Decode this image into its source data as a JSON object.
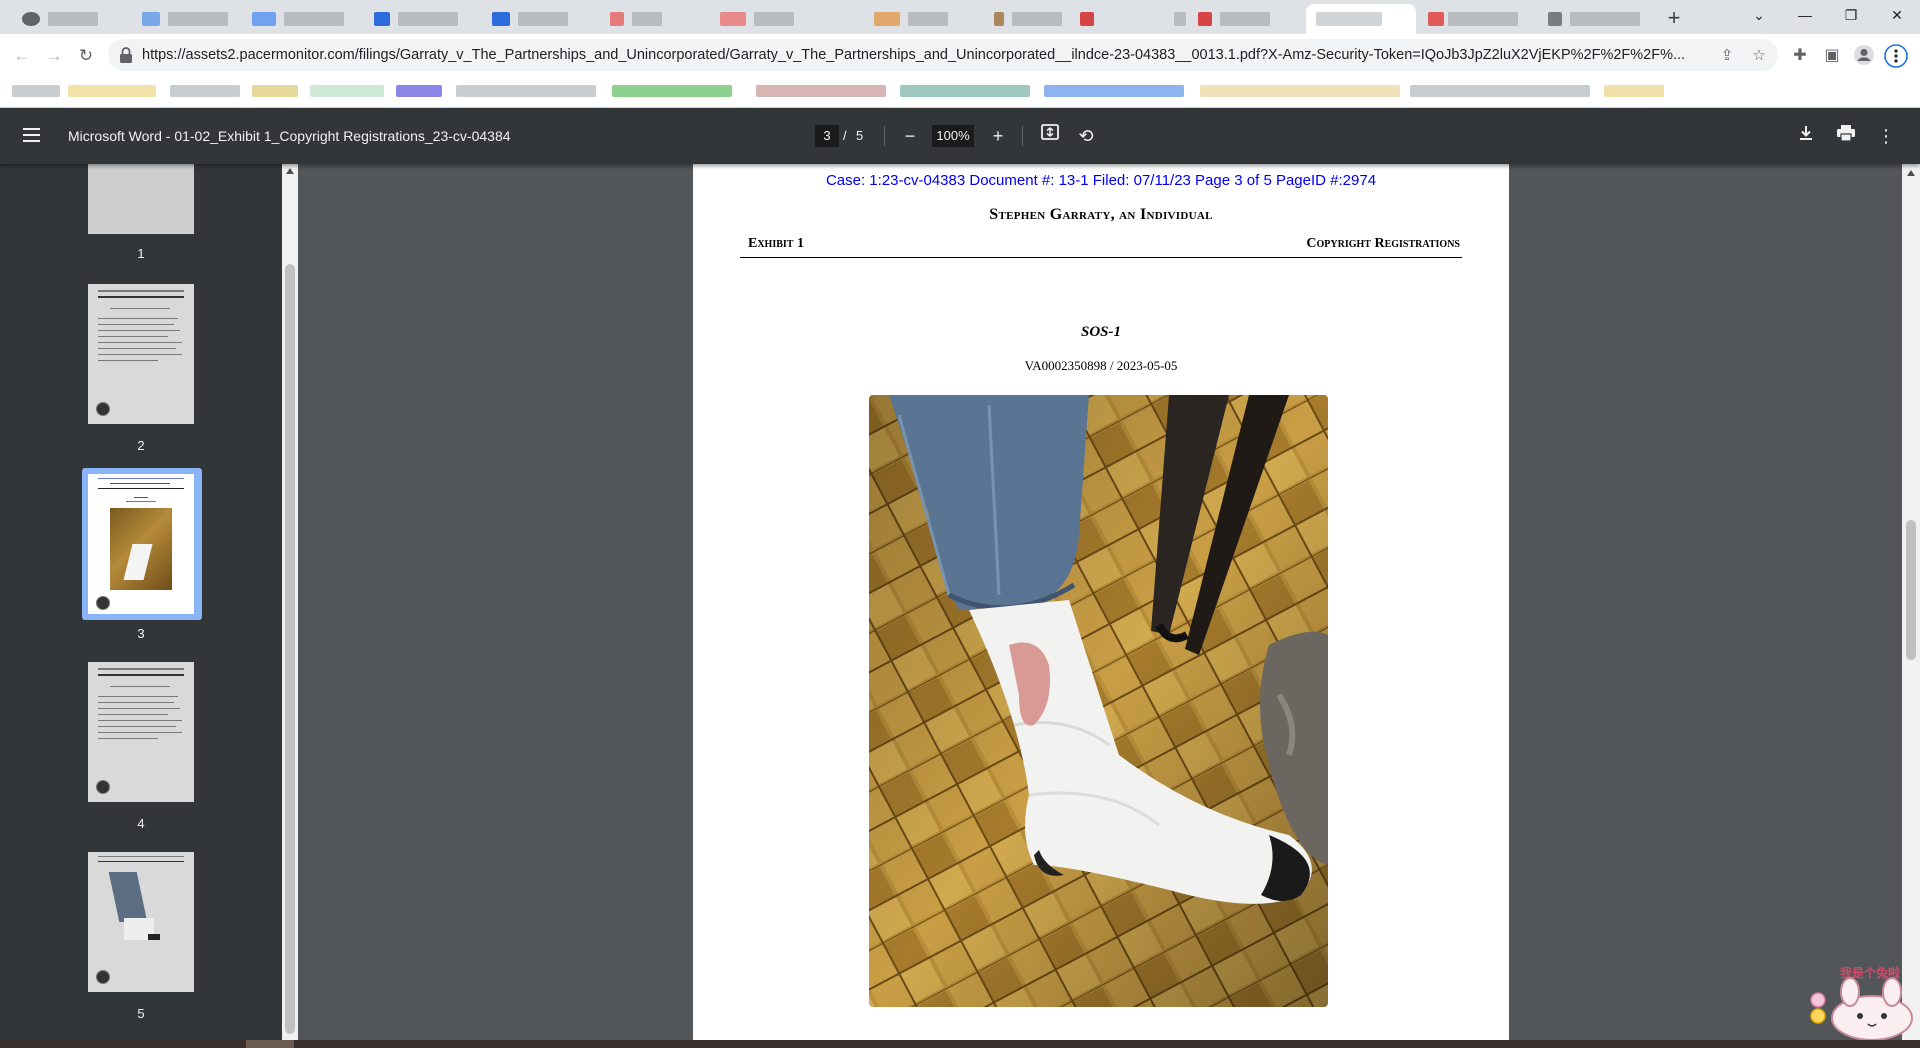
{
  "browser": {
    "url": "https://assets2.pacermonitor.com/filings/Garraty_v_The_Partnerships_and_Unincorporated/Garraty_v_The_Partnerships_and_Unincorporated__ilndce-23-04383__0013.1.pdf?X-Amz-Security-Token=IQoJb3JpZ2luX2VjEKP%2F%2F%2F%...",
    "new_tab_label": "+",
    "window_controls": {
      "minimize": "—",
      "restore": "❐",
      "close": "✕"
    }
  },
  "pdf_viewer": {
    "title": "Microsoft Word - 01-02_Exhibit 1_Copyright Registrations_23-cv-04384",
    "current_page": "3",
    "page_separator": "/",
    "total_pages": "5",
    "zoom": "100%"
  },
  "sidebar": {
    "thumbnails": [
      {
        "label": "1"
      },
      {
        "label": "2"
      },
      {
        "label": "3",
        "selected": true
      },
      {
        "label": "4"
      },
      {
        "label": "5"
      }
    ]
  },
  "document": {
    "case_header": "Case: 1:23-cv-04383 Document #: 13-1 Filed: 07/11/23 Page 3 of 5 PageID #:2974",
    "heading": "Stephen Garraty, an Individual",
    "exhibit_label": "Exhibit 1",
    "section_label": "Copyright Registrations",
    "work_title": "SOS-1",
    "registration": "VA0002350898 / 2023-05-05"
  },
  "overlay": {
    "mascot_text": "我是个兔啦"
  },
  "colors": {
    "link_blue": "#0000ee",
    "viewer_toolbar": "#323639",
    "viewer_background": "#525659",
    "selected_thumb": "#8ab4f8"
  }
}
